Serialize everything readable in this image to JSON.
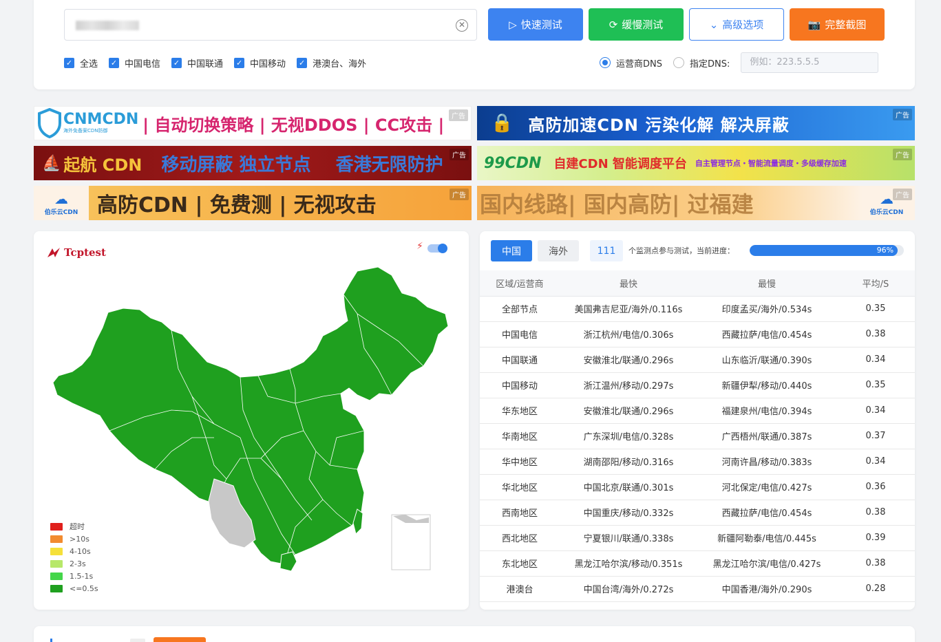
{
  "search": {
    "placeholder": "",
    "clear_icon": "close-circle-icon"
  },
  "buttons": {
    "quick": "快速测试",
    "slow": "缓慢测试",
    "advanced": "高级选项",
    "screenshot": "完整截图"
  },
  "filters": [
    {
      "label": "全选",
      "checked": true
    },
    {
      "label": "中国电信",
      "checked": true
    },
    {
      "label": "中国联通",
      "checked": true
    },
    {
      "label": "中国移动",
      "checked": true
    },
    {
      "label": "港澳台、海外",
      "checked": true
    }
  ],
  "dns": {
    "isp_label": "运营商DNS",
    "custom_label": "指定DNS:",
    "custom_placeholder": "例如：223.5.5.5",
    "selected": "isp"
  },
  "ads": {
    "tag": "广告",
    "b1": {
      "brand": "CNMCDN",
      "sub": "海外免备案CDN防御",
      "text": "| 自动切换策略 | 无视DDOS | CC攻击 |"
    },
    "b2": {
      "text": "高防加速CDN  污染化解  解决屏蔽"
    },
    "b3": {
      "brand": "起航 CDN",
      "text": "移动屏蔽 独立节点    香港无限防护"
    },
    "b4": {
      "brand": "99CDN",
      "text": "自建CDN 智能调度平台",
      "sub": "自主管理节点・智能流量调度・多级缓存加速"
    },
    "b5": {
      "brand": "伯乐云CDN",
      "text": "高防CDN | 免费测 | 无视攻击"
    },
    "b6": {
      "brand": "伯乐云CDN",
      "text": "国内线路| 国内高防| 过福建"
    }
  },
  "map": {
    "logo_text": "Tcptest",
    "legend": [
      {
        "label": "超时",
        "color": "#e0201c"
      },
      {
        "label": ">10s",
        "color": "#f28b30"
      },
      {
        "label": "4-10s",
        "color": "#f5e03a"
      },
      {
        "label": "2-3s",
        "color": "#b7e86a"
      },
      {
        "label": "1.5-1s",
        "color": "#44d64a"
      },
      {
        "label": "<=0.5s",
        "color": "#1fa01f"
      }
    ],
    "fill_color": "#1fa01f",
    "no_data_color": "#c8c8c8"
  },
  "results": {
    "tabs": [
      "中国",
      "海外"
    ],
    "active_tab": "中国",
    "node_count": "111",
    "progress_text": "个监测点参与测试，当前进度：",
    "progress_pct": 96,
    "progress_label": "96%",
    "columns": [
      "区域/运营商",
      "最快",
      "最慢",
      "平均/S"
    ],
    "rows": [
      [
        "全部节点",
        "美国弗吉尼亚/海外/0.116s",
        "印度孟买/海外/0.534s",
        "0.35"
      ],
      [
        "中国电信",
        "浙江杭州/电信/0.306s",
        "西藏拉萨/电信/0.454s",
        "0.38"
      ],
      [
        "中国联通",
        "安徽淮北/联通/0.296s",
        "山东临沂/联通/0.390s",
        "0.34"
      ],
      [
        "中国移动",
        "浙江温州/移动/0.297s",
        "新疆伊犁/移动/0.440s",
        "0.35"
      ],
      [
        "华东地区",
        "安徽淮北/联通/0.296s",
        "福建泉州/电信/0.394s",
        "0.34"
      ],
      [
        "华南地区",
        "广东深圳/电信/0.328s",
        "广西梧州/联通/0.387s",
        "0.37"
      ],
      [
        "华中地区",
        "湖南邵阳/移动/0.316s",
        "河南许昌/移动/0.383s",
        "0.34"
      ],
      [
        "华北地区",
        "中国北京/联通/0.301s",
        "河北保定/电信/0.427s",
        "0.36"
      ],
      [
        "西南地区",
        "中国重庆/移动/0.332s",
        "西藏拉萨/电信/0.454s",
        "0.38"
      ],
      [
        "西北地区",
        "宁夏银川/联通/0.338s",
        "新疆阿勒泰/电信/0.445s",
        "0.39"
      ],
      [
        "东北地区",
        "黑龙江哈尔滨/移动/0.351s",
        "黑龙江哈尔滨/电信/0.427s",
        "0.38"
      ],
      [
        "港澳台",
        "中国台湾/海外/0.272s",
        "中国香港/海外/0.290s",
        "0.28"
      ]
    ]
  }
}
